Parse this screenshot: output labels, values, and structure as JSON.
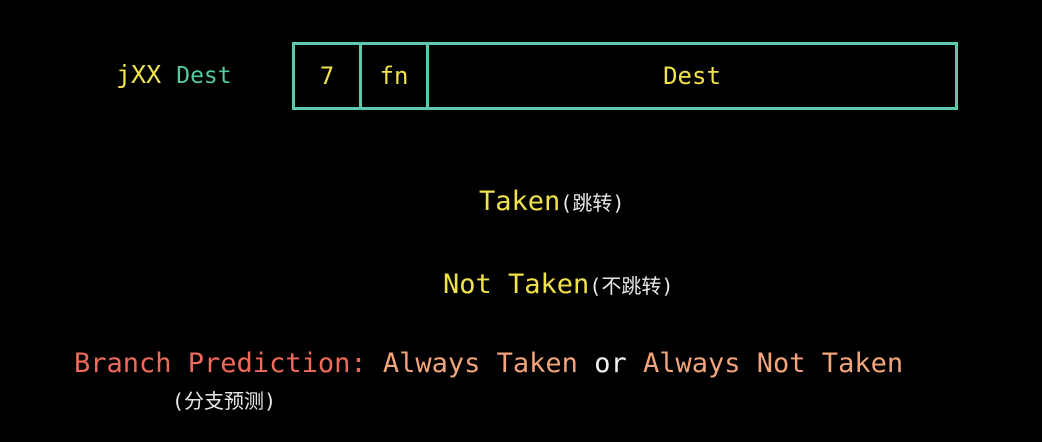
{
  "instruction": {
    "mnemonic": "jXX",
    "operand": "Dest"
  },
  "encoding": {
    "icode": "7",
    "ifun": "fn",
    "dest": "Dest"
  },
  "taken": {
    "label": "Taken",
    "note": "(跳转)"
  },
  "not_taken": {
    "label": "Not Taken",
    "note": "(不跳转)"
  },
  "branch_prediction": {
    "lead": "Branch Prediction:",
    "option1": "Always Taken",
    "conjunction": "or",
    "option2": "Always Not Taken",
    "note": "(分支预测)"
  },
  "colors": {
    "yellow": "#f0e24a",
    "teal": "#5cc8b0",
    "red": "#ee6a5a",
    "orange": "#f2a57a",
    "white": "#f2f2f2"
  }
}
